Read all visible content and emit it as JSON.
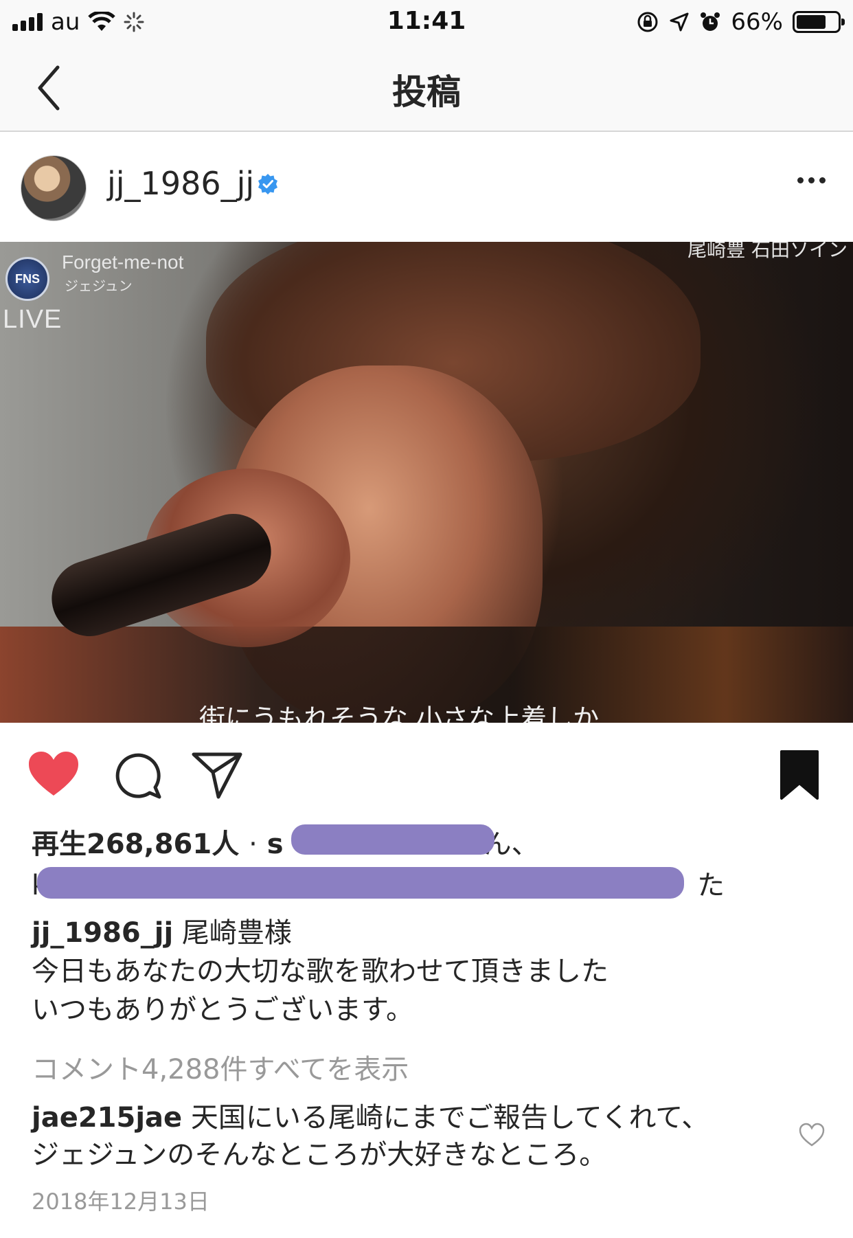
{
  "status_bar": {
    "carrier": "au",
    "time": "11:41",
    "battery_percent": "66%",
    "battery_level": 0.66
  },
  "nav": {
    "title": "投稿",
    "back_icon": "chevron-left-icon"
  },
  "post": {
    "username": "jj_1986_jj",
    "verified": true,
    "media": {
      "tv_logo": "FNS",
      "song_title": "Forget-me-not",
      "singer": "ジェジュン",
      "live_label": "LIVE",
      "top_right_caption": "尾崎豊 石田ソイン",
      "subtitle": "街にうもれそうな 小さな上着しか"
    },
    "liked": true,
    "saved": true,
    "views": {
      "prefix": "再生",
      "count": "268,861",
      "suffix": "人",
      "separator": "·",
      "liker_first_char": "s",
      "line1_end": "ん、",
      "line2_start": "k",
      "line2_end": "た"
    },
    "caption": {
      "username": "jj_1986_jj",
      "lines": [
        "尾崎豊様",
        "今日もあなたの大切な歌を歌わせて頂きました",
        "いつもありがとうございます。"
      ]
    },
    "view_all_comments": "コメント4,288件すべてを表示",
    "top_comment": {
      "username": "jae215jae",
      "text_line1": "天国にいる尾崎にまでご報告してくれて、",
      "text_line2": "ジェジュンのそんなところが大好きなところ。"
    },
    "date": "2018年12月13日"
  },
  "colors": {
    "like_red": "#ed4956",
    "verified_blue": "#3897f0",
    "redaction_purple": "#8b7fc2",
    "muted_text": "#999999"
  }
}
